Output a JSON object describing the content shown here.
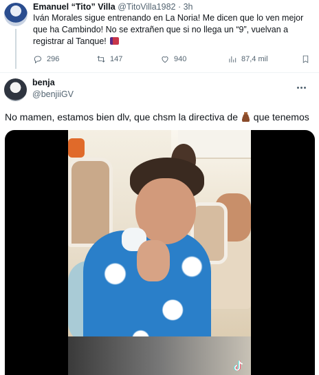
{
  "quoted_tweet": {
    "display_name": "Emanuel “Tito” Villa",
    "handle": "@TitoVilla1982",
    "separator": "·",
    "time": "3h",
    "text": "Iván Morales sigue entrenando en La Noria! Me dicen que lo ven mejor que ha Cambindo! No se extrañen que si no llega un “9”, vuelvan a registrar al Tanque!",
    "flag_icon": "flag-icon",
    "replies": "296",
    "retweets": "147",
    "likes": "940",
    "views": "87,4 mil"
  },
  "reply_tweet": {
    "display_name": "benja",
    "handle": "@benjiiGV",
    "text_before": "No mamen, estamos bien dlv, que chsm la directiva de ",
    "text_after": " que tenemos",
    "emoji_icon": "poop-emoji-icon",
    "more_icon": "more-icon"
  },
  "colors": {
    "text": "#0f1419",
    "secondary": "#536471",
    "divider": "#eff3f4",
    "thread_line": "#cfd9de"
  }
}
